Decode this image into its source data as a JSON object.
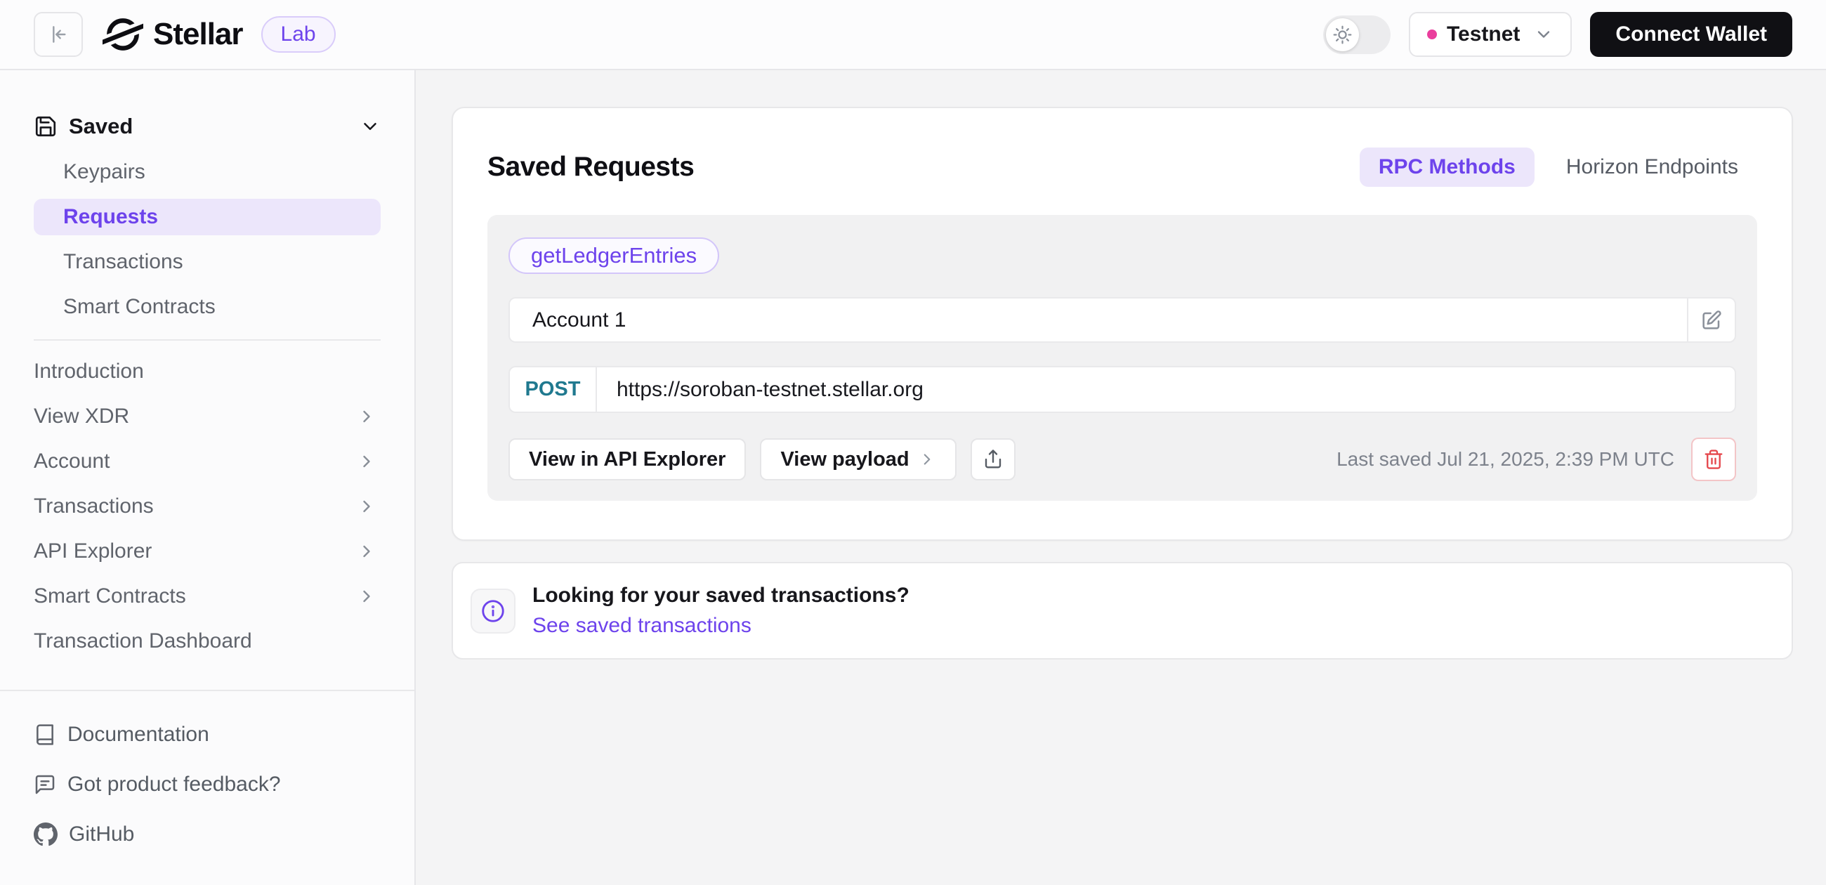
{
  "header": {
    "brand": "Stellar",
    "badge": "Lab",
    "network": {
      "label": "Testnet",
      "status_color": "#ea3e9d"
    },
    "connect_wallet_label": "Connect Wallet"
  },
  "sidebar": {
    "saved_group": {
      "label": "Saved",
      "items": [
        {
          "label": "Keypairs"
        },
        {
          "label": "Requests"
        },
        {
          "label": "Transactions"
        },
        {
          "label": "Smart Contracts"
        }
      ],
      "active_item": "Requests"
    },
    "nav_items": [
      {
        "label": "Introduction"
      },
      {
        "label": "View XDR"
      },
      {
        "label": "Account"
      },
      {
        "label": "Transactions"
      },
      {
        "label": "API Explorer"
      },
      {
        "label": "Smart Contracts"
      },
      {
        "label": "Transaction Dashboard"
      }
    ],
    "footer_items": [
      {
        "label": "Documentation",
        "icon": "book-icon"
      },
      {
        "label": "Got product feedback?",
        "icon": "feedback-icon"
      },
      {
        "label": "GitHub",
        "icon": "github-icon"
      }
    ]
  },
  "main": {
    "card": {
      "title": "Saved Requests",
      "tabs": [
        {
          "label": "RPC Methods",
          "active": true
        },
        {
          "label": "Horizon Endpoints",
          "active": false
        }
      ],
      "request": {
        "method_badge": "getLedgerEntries",
        "name": "Account 1",
        "http_method": "POST",
        "url": "https://soroban-testnet.stellar.org",
        "view_api_explorer_label": "View in API Explorer",
        "view_payload_label": "View payload",
        "last_saved": "Last saved Jul 21, 2025, 2:39 PM UTC"
      }
    },
    "info_box": {
      "title": "Looking for your saved transactions?",
      "link_label": "See saved transactions"
    }
  },
  "colors": {
    "accent_purple": "#6d43ec",
    "accent_purple_bg": "#ece6fb",
    "post_teal": "#20798f",
    "network_pink": "#ea3e9d",
    "danger_red": "#e5484d",
    "wallet_black": "#101014"
  }
}
